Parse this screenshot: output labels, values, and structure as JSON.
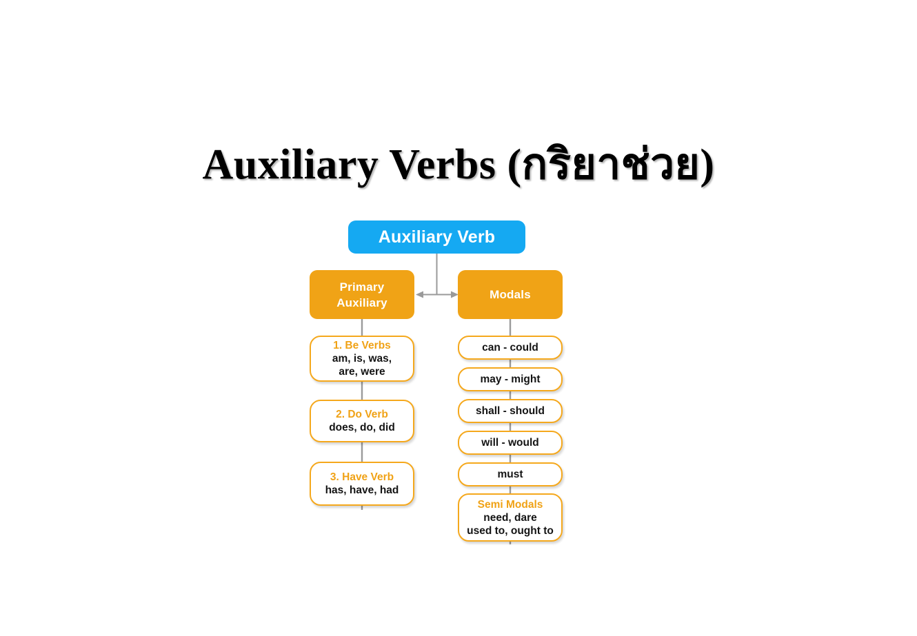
{
  "page": {
    "title": "Auxiliary Verbs (กริยาช่วย)",
    "background_color": "#ffffff"
  },
  "colors": {
    "root_fill": "#15a9f2",
    "branch_fill": "#f0a316",
    "leaf_border": "#f5a81c",
    "leaf_fill": "#ffffff",
    "heading_text": "#f0a216",
    "body_text": "#141414",
    "connector": "#9a9a9a",
    "title_text": "#000000"
  },
  "diagram": {
    "root": {
      "label": "Auxiliary Verb"
    },
    "branches": [
      {
        "label": "Primary Auxiliary"
      },
      {
        "label": "Modals"
      }
    ],
    "primary_auxiliary_items": [
      {
        "heading": "1. Be Verbs",
        "lines": [
          "am, is, was,",
          "are, were"
        ]
      },
      {
        "heading": "2. Do Verb",
        "lines": [
          "does, do, did"
        ]
      },
      {
        "heading": "3. Have Verb",
        "lines": [
          "has, have, had"
        ]
      }
    ],
    "modal_items": [
      {
        "heading": "",
        "lines": [
          "can - could"
        ]
      },
      {
        "heading": "",
        "lines": [
          "may - might"
        ]
      },
      {
        "heading": "",
        "lines": [
          "shall - should"
        ]
      },
      {
        "heading": "",
        "lines": [
          "will - would"
        ]
      },
      {
        "heading": "",
        "lines": [
          "must"
        ]
      },
      {
        "heading": "Semi Modals",
        "lines": [
          "need, dare",
          "used to, ought to"
        ]
      }
    ]
  }
}
